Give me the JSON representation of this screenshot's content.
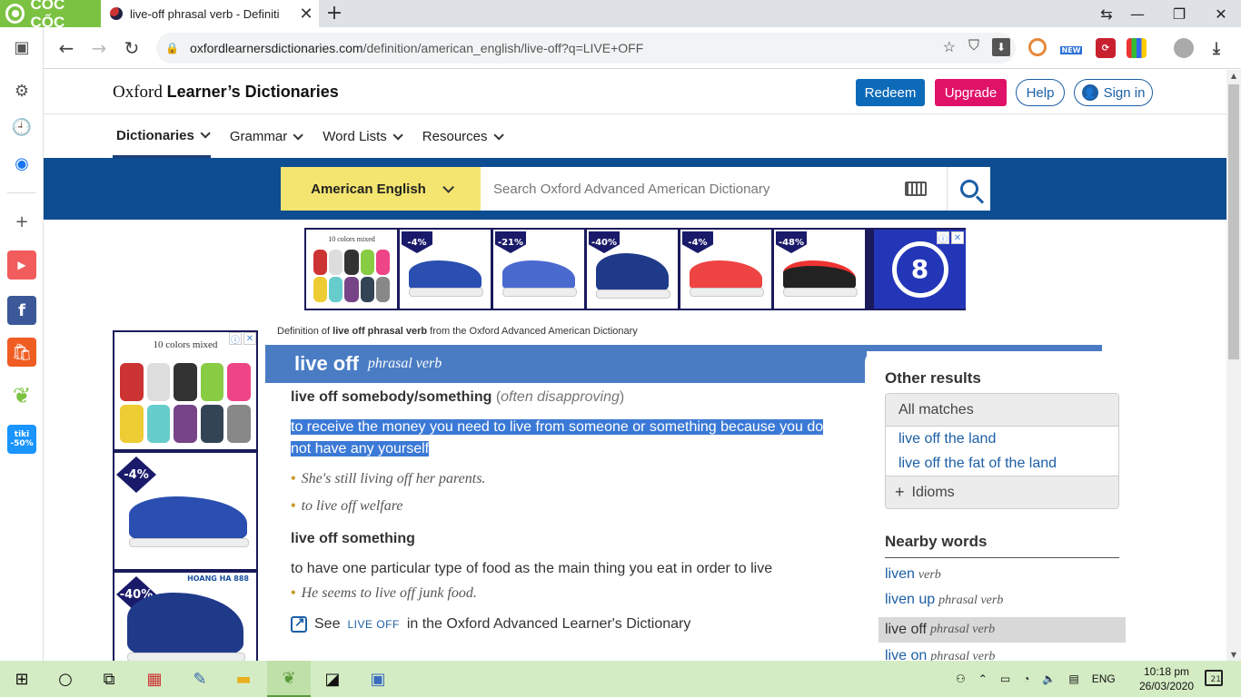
{
  "browser": {
    "brand": "CỐC CỐC",
    "tab_title": "live-off phrasal verb - Definiti",
    "url_host": "oxfordlearnersdictionaries.com",
    "url_path": "/definition/american_english/live-off?q=LIVE+OFF",
    "ext_new_label": "NEW",
    "sidebar_tiki": "tiki\n-50%"
  },
  "site": {
    "logo_serif": "Oxford",
    "logo_bold": "Learner’s Dictionaries",
    "redeem": "Redeem",
    "upgrade": "Upgrade",
    "help": "Help",
    "signin": "Sign in",
    "nav": [
      "Dictionaries",
      "Grammar",
      "Word Lists",
      "Resources"
    ],
    "dictionary_selector": "American English",
    "search_placeholder": "Search Oxford Advanced American Dictionary"
  },
  "ads": {
    "ten_colors": "10 colors mixed",
    "discounts": [
      "-4%",
      "-21%",
      "-40%",
      "-4%",
      "-48%"
    ],
    "sky_discounts": [
      "-4%",
      "-40%"
    ],
    "hoangha": "HOANG HA 888"
  },
  "entry": {
    "source_prefix": "Definition of ",
    "source_bold": "live off phrasal verb",
    "source_suffix": " from the Oxford Advanced American Dictionary",
    "headword": "live off",
    "pos": "phrasal verb",
    "sense1_pv": "live off somebody/something",
    "sense1_label_open": "(",
    "sense1_label": "often disapproving",
    "sense1_label_close": ")",
    "sense1_def": "to receive the money you need to live from someone or something because you do not have any yourself",
    "sense1_ex1": "She's still living off her parents.",
    "sense1_ex2": "to live off welfare",
    "sense2_pv": "live off something",
    "sense2_def": "to have one particular type of food as the main thing you eat in order to live",
    "sense2_ex1": "He seems to live off junk food.",
    "see_prefix": "See",
    "see_sc": "LIVE OFF",
    "see_suffix": "in the Oxford Advanced Learner's Dictionary"
  },
  "sidebar": {
    "other_results": "Other results",
    "all_matches": "All matches",
    "matches": [
      "live off the land",
      "live off the fat of the land"
    ],
    "idioms": "Idioms",
    "nearby_title": "Nearby words",
    "nearby": [
      {
        "word": "liven",
        "pos": "verb"
      },
      {
        "word": "liven up",
        "pos": "phrasal verb"
      },
      {
        "word": "live off",
        "pos": "phrasal verb"
      },
      {
        "word": "live on",
        "pos": "phrasal verb"
      }
    ]
  },
  "taskbar": {
    "lang": "ENG",
    "time": "10:18 pm",
    "date": "26/03/2020",
    "notifications": "21"
  }
}
